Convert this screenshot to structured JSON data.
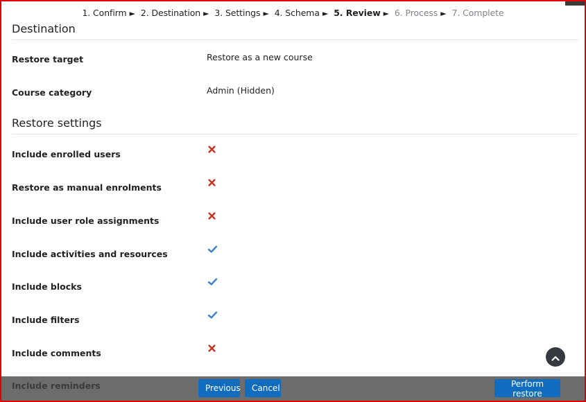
{
  "steps": [
    {
      "label": "1. Confirm",
      "state": "done"
    },
    {
      "label": "2. Destination",
      "state": "done"
    },
    {
      "label": "3. Settings",
      "state": "done"
    },
    {
      "label": "4. Schema",
      "state": "done"
    },
    {
      "label": "5. Review",
      "state": "current"
    },
    {
      "label": "6. Process",
      "state": "future"
    },
    {
      "label": "7. Complete",
      "state": "future"
    }
  ],
  "step_separator": "►",
  "destination": {
    "title": "Destination",
    "rows": [
      {
        "label": "Restore target",
        "value": "Restore as a new course"
      },
      {
        "label": "Course category",
        "value": "Admin (Hidden)"
      }
    ]
  },
  "restore_settings": {
    "title": "Restore settings",
    "rows": [
      {
        "label": "Include enrolled users",
        "icon": "cross-icon"
      },
      {
        "label": "Restore as manual enrolments",
        "icon": "cross-icon"
      },
      {
        "label": "Include user role assignments",
        "icon": "cross-icon"
      },
      {
        "label": "Include activities and resources",
        "icon": "check-icon"
      },
      {
        "label": "Include blocks",
        "icon": "check-icon"
      },
      {
        "label": "Include filters",
        "icon": "check-icon"
      },
      {
        "label": "Include comments",
        "icon": "cross-icon"
      }
    ]
  },
  "footer": {
    "peek_label": "Include reminders",
    "previous_label": "Previous",
    "cancel_label": "Cancel",
    "perform_label": "Perform restore"
  },
  "colors": {
    "cross": "#ca3120",
    "check": "#3c7fc4",
    "button": "#0f6cbf",
    "footer_bg": "#6c6c6c",
    "frame": "#e00000"
  }
}
